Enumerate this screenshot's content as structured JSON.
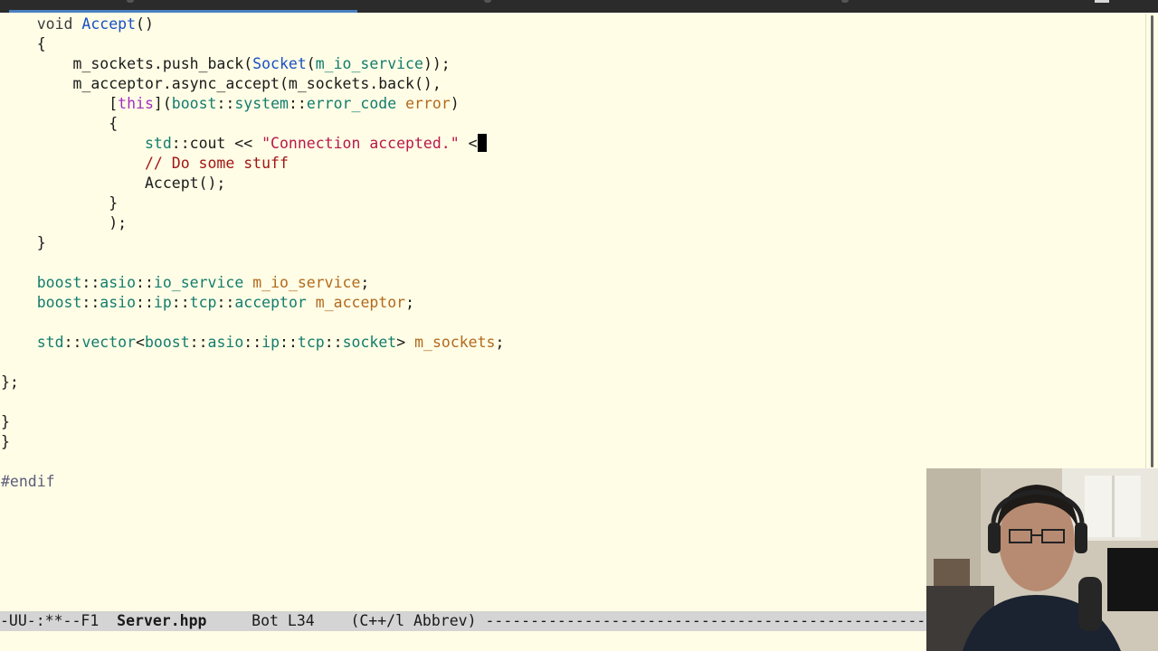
{
  "editor": {
    "lines": [
      {
        "indent": "    ",
        "tokens": [
          {
            "t": "void ",
            "c": "kw"
          },
          {
            "t": "Accept",
            "c": "fn"
          },
          {
            "t": "()",
            "c": ""
          }
        ]
      },
      {
        "indent": "    ",
        "tokens": [
          {
            "t": "{",
            "c": ""
          }
        ]
      },
      {
        "indent": "        ",
        "tokens": [
          {
            "t": "m_sockets.push_back(",
            "c": ""
          },
          {
            "t": "Socket",
            "c": "fn"
          },
          {
            "t": "(",
            "c": ""
          },
          {
            "t": "m_io_service",
            "c": "ty"
          },
          {
            "t": "));",
            "c": ""
          }
        ]
      },
      {
        "indent": "        ",
        "tokens": [
          {
            "t": "m_acceptor.async_accept(m_sockets.back(),",
            "c": ""
          }
        ]
      },
      {
        "indent": "            ",
        "tokens": [
          {
            "t": "[",
            "c": ""
          },
          {
            "t": "this",
            "c": "this"
          },
          {
            "t": "](",
            "c": ""
          },
          {
            "t": "boost",
            "c": "ty"
          },
          {
            "t": "::",
            "c": ""
          },
          {
            "t": "system",
            "c": "ty"
          },
          {
            "t": "::",
            "c": ""
          },
          {
            "t": "error_code",
            "c": "ty"
          },
          {
            "t": " ",
            "c": ""
          },
          {
            "t": "error",
            "c": "var"
          },
          {
            "t": ")",
            "c": ""
          }
        ]
      },
      {
        "indent": "            ",
        "tokens": [
          {
            "t": "{",
            "c": ""
          }
        ]
      },
      {
        "indent": "                ",
        "tokens": [
          {
            "t": "std",
            "c": "ty"
          },
          {
            "t": "::cout << ",
            "c": ""
          },
          {
            "t": "\"Connection accepted.\"",
            "c": "str"
          },
          {
            "t": " <",
            "c": ""
          }
        ],
        "cursor": true
      },
      {
        "indent": "                ",
        "tokens": [
          {
            "t": "// Do some stuff",
            "c": "cmt"
          }
        ]
      },
      {
        "indent": "                ",
        "tokens": [
          {
            "t": "Accept();",
            "c": ""
          }
        ]
      },
      {
        "indent": "            ",
        "tokens": [
          {
            "t": "}",
            "c": ""
          }
        ]
      },
      {
        "indent": "            ",
        "tokens": [
          {
            "t": ");",
            "c": ""
          }
        ]
      },
      {
        "indent": "    ",
        "tokens": [
          {
            "t": "}",
            "c": ""
          }
        ]
      },
      {
        "indent": "",
        "tokens": []
      },
      {
        "indent": "    ",
        "tokens": [
          {
            "t": "boost",
            "c": "ty"
          },
          {
            "t": "::",
            "c": ""
          },
          {
            "t": "asio",
            "c": "ty"
          },
          {
            "t": "::",
            "c": ""
          },
          {
            "t": "io_service",
            "c": "ty"
          },
          {
            "t": " ",
            "c": ""
          },
          {
            "t": "m_io_service",
            "c": "var"
          },
          {
            "t": ";",
            "c": ""
          }
        ]
      },
      {
        "indent": "    ",
        "tokens": [
          {
            "t": "boost",
            "c": "ty"
          },
          {
            "t": "::",
            "c": ""
          },
          {
            "t": "asio",
            "c": "ty"
          },
          {
            "t": "::",
            "c": ""
          },
          {
            "t": "ip",
            "c": "ty"
          },
          {
            "t": "::",
            "c": ""
          },
          {
            "t": "tcp",
            "c": "ty"
          },
          {
            "t": "::",
            "c": ""
          },
          {
            "t": "acceptor",
            "c": "ty"
          },
          {
            "t": " ",
            "c": ""
          },
          {
            "t": "m_acceptor",
            "c": "var"
          },
          {
            "t": ";",
            "c": ""
          }
        ]
      },
      {
        "indent": "",
        "tokens": []
      },
      {
        "indent": "    ",
        "tokens": [
          {
            "t": "std",
            "c": "ty"
          },
          {
            "t": "::",
            "c": ""
          },
          {
            "t": "vector",
            "c": "ty"
          },
          {
            "t": "<",
            "c": ""
          },
          {
            "t": "boost",
            "c": "ty"
          },
          {
            "t": "::",
            "c": ""
          },
          {
            "t": "asio",
            "c": "ty"
          },
          {
            "t": "::",
            "c": ""
          },
          {
            "t": "ip",
            "c": "ty"
          },
          {
            "t": "::",
            "c": ""
          },
          {
            "t": "tcp",
            "c": "ty"
          },
          {
            "t": "::",
            "c": ""
          },
          {
            "t": "socket",
            "c": "ty"
          },
          {
            "t": "> ",
            "c": ""
          },
          {
            "t": "m_sockets",
            "c": "var"
          },
          {
            "t": ";",
            "c": ""
          }
        ]
      },
      {
        "indent": "",
        "tokens": []
      },
      {
        "indent": "",
        "tokens": [
          {
            "t": "};",
            "c": ""
          }
        ]
      },
      {
        "indent": "",
        "tokens": []
      },
      {
        "indent": "",
        "tokens": [
          {
            "t": "}",
            "c": ""
          }
        ]
      },
      {
        "indent": "",
        "tokens": [
          {
            "t": "}",
            "c": ""
          }
        ]
      },
      {
        "indent": "",
        "tokens": []
      },
      {
        "indent": "",
        "tokens": [
          {
            "t": "#endif",
            "c": "pre"
          }
        ]
      }
    ]
  },
  "modeline": {
    "status": "-UU-:**--F1  ",
    "buffer_name": "Server.hpp",
    "position": "     Bot L34    ",
    "modes": "(C++/l Abbrev)",
    "fill": " ----------------------------------------------------------------------"
  },
  "colors": {
    "background": "#fffde6",
    "modeline_bg": "#d4d4d4",
    "keyword": "#3b3b3b",
    "function": "#1a4fc4",
    "type": "#137c6e",
    "variable": "#b2691d",
    "string": "#b8184a",
    "comment": "#a31515",
    "this": "#a12ec1"
  },
  "webcam": {
    "icon": "person-webcam-overlay"
  }
}
